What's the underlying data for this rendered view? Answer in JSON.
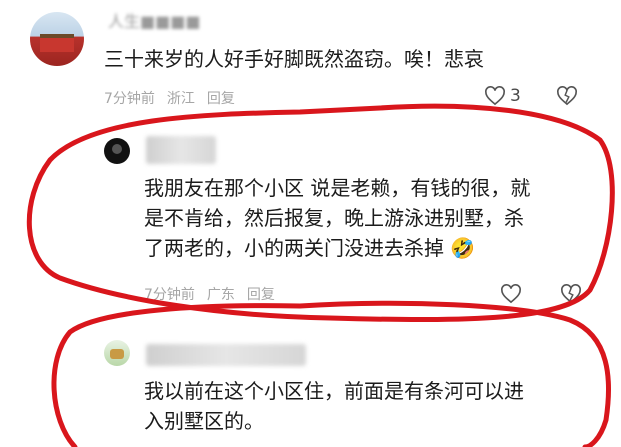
{
  "comments": [
    {
      "username": "人生■■■■",
      "text": "三十来岁的人好手好脚既然盗窃。唉！悲哀",
      "time": "7分钟前",
      "location": "浙江",
      "reply_label": "回复",
      "likes": "3"
    },
    {
      "username": "■■■■",
      "text_lines": [
        "我朋友在那个小区 说是老赖，有钱的很，就",
        "是不肯给，然后报复，晚上游泳进别墅，杀",
        "了两老的，小的两关门没进去杀掉"
      ],
      "emoji": "🤣",
      "time": "7分钟前",
      "location": "广东",
      "reply_label": "回复"
    },
    {
      "username": "■■■■■",
      "text_lines": [
        "我以前在这个小区住，前面是有条河可以进",
        "入别墅区的。"
      ]
    }
  ],
  "colors": {
    "annotation_red": "#d9161c",
    "meta_gray": "#a6a6a6"
  },
  "icons": [
    "heart-outline-icon",
    "broken-heart-icon",
    "avatar-icon"
  ]
}
